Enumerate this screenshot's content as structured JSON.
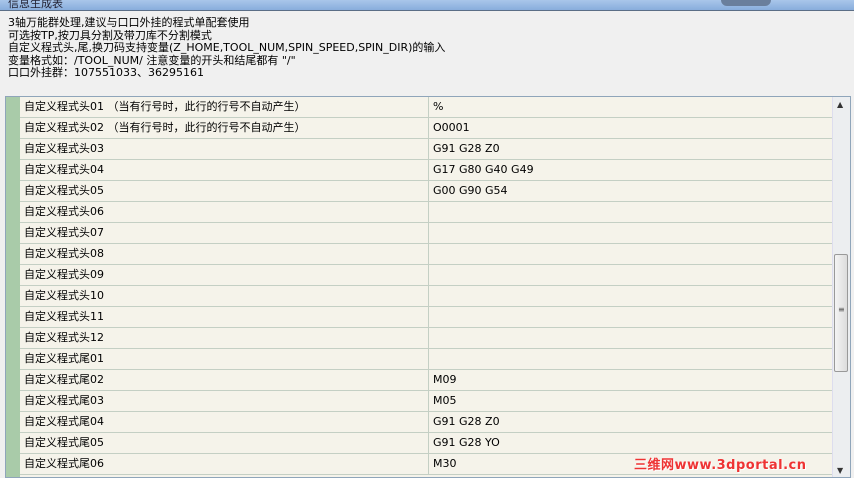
{
  "window": {
    "title": "信息生成表"
  },
  "notes": [
    "3轴万能群处理,建议与口口外挂的程式单配套使用",
    "可选按TP,按刀具分割及带刀库不分割模式",
    "自定义程式头,尾,换刀码支持变量(Z_HOME,TOOL_NUM,SPIN_SPEED,SPIN_DIR)的输入",
    "变量格式如：/TOOL_NUM/ 注意变量的开头和结尾都有 \"/\"",
    "口口外挂群：107551033、36295161"
  ],
  "rows": [
    {
      "name": "自定义程式头01 （当有行号时，此行的行号不自动产生）",
      "value": "%"
    },
    {
      "name": "自定义程式头02 （当有行号时，此行的行号不自动产生）",
      "value": "O0001"
    },
    {
      "name": "自定义程式头03",
      "value": "G91 G28 Z0"
    },
    {
      "name": "自定义程式头04",
      "value": "G17 G80 G40 G49"
    },
    {
      "name": "自定义程式头05",
      "value": "G00 G90 G54"
    },
    {
      "name": "自定义程式头06",
      "value": ""
    },
    {
      "name": "自定义程式头07",
      "value": ""
    },
    {
      "name": "自定义程式头08",
      "value": ""
    },
    {
      "name": "自定义程式头09",
      "value": ""
    },
    {
      "name": "自定义程式头10",
      "value": ""
    },
    {
      "name": "自定义程式头11",
      "value": ""
    },
    {
      "name": "自定义程式头12",
      "value": ""
    },
    {
      "name": "自定义程式尾01",
      "value": ""
    },
    {
      "name": "自定义程式尾02",
      "value": "M09"
    },
    {
      "name": "自定义程式尾03",
      "value": "M05"
    },
    {
      "name": "自定义程式尾04",
      "value": "G91 G28 Z0"
    },
    {
      "name": "自定义程式尾05",
      "value": "G91 G28 YO"
    },
    {
      "name": "自定义程式尾06",
      "value": "M30"
    }
  ],
  "watermark": "三维网www.3dportal.cn"
}
